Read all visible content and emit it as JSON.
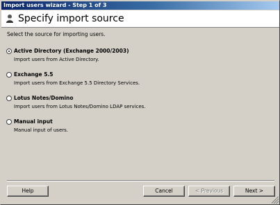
{
  "window": {
    "title": "Import users wizard - Step 1 of 3"
  },
  "header": {
    "title": "Specify import source",
    "icon": "wizard-user-icon"
  },
  "content": {
    "instructions": "Select the source for importing users.",
    "options": [
      {
        "label": "Active Directory (Exchange 2000/2003)",
        "description": "Import users from Active Directory.",
        "checked": true
      },
      {
        "label": "Exchange 5.5",
        "description": "Import users from Exchange 5.5 Directory Services.",
        "checked": false
      },
      {
        "label": "Lotus Notes/Domino",
        "description": "Import users from Lotus Notes/Domino LDAP services.",
        "checked": false
      },
      {
        "label": "Manual input",
        "description": "Manual input of users.",
        "checked": false
      }
    ]
  },
  "buttons": {
    "help": "Help",
    "cancel": "Cancel",
    "previous": "< Previous",
    "next": "Next >"
  }
}
